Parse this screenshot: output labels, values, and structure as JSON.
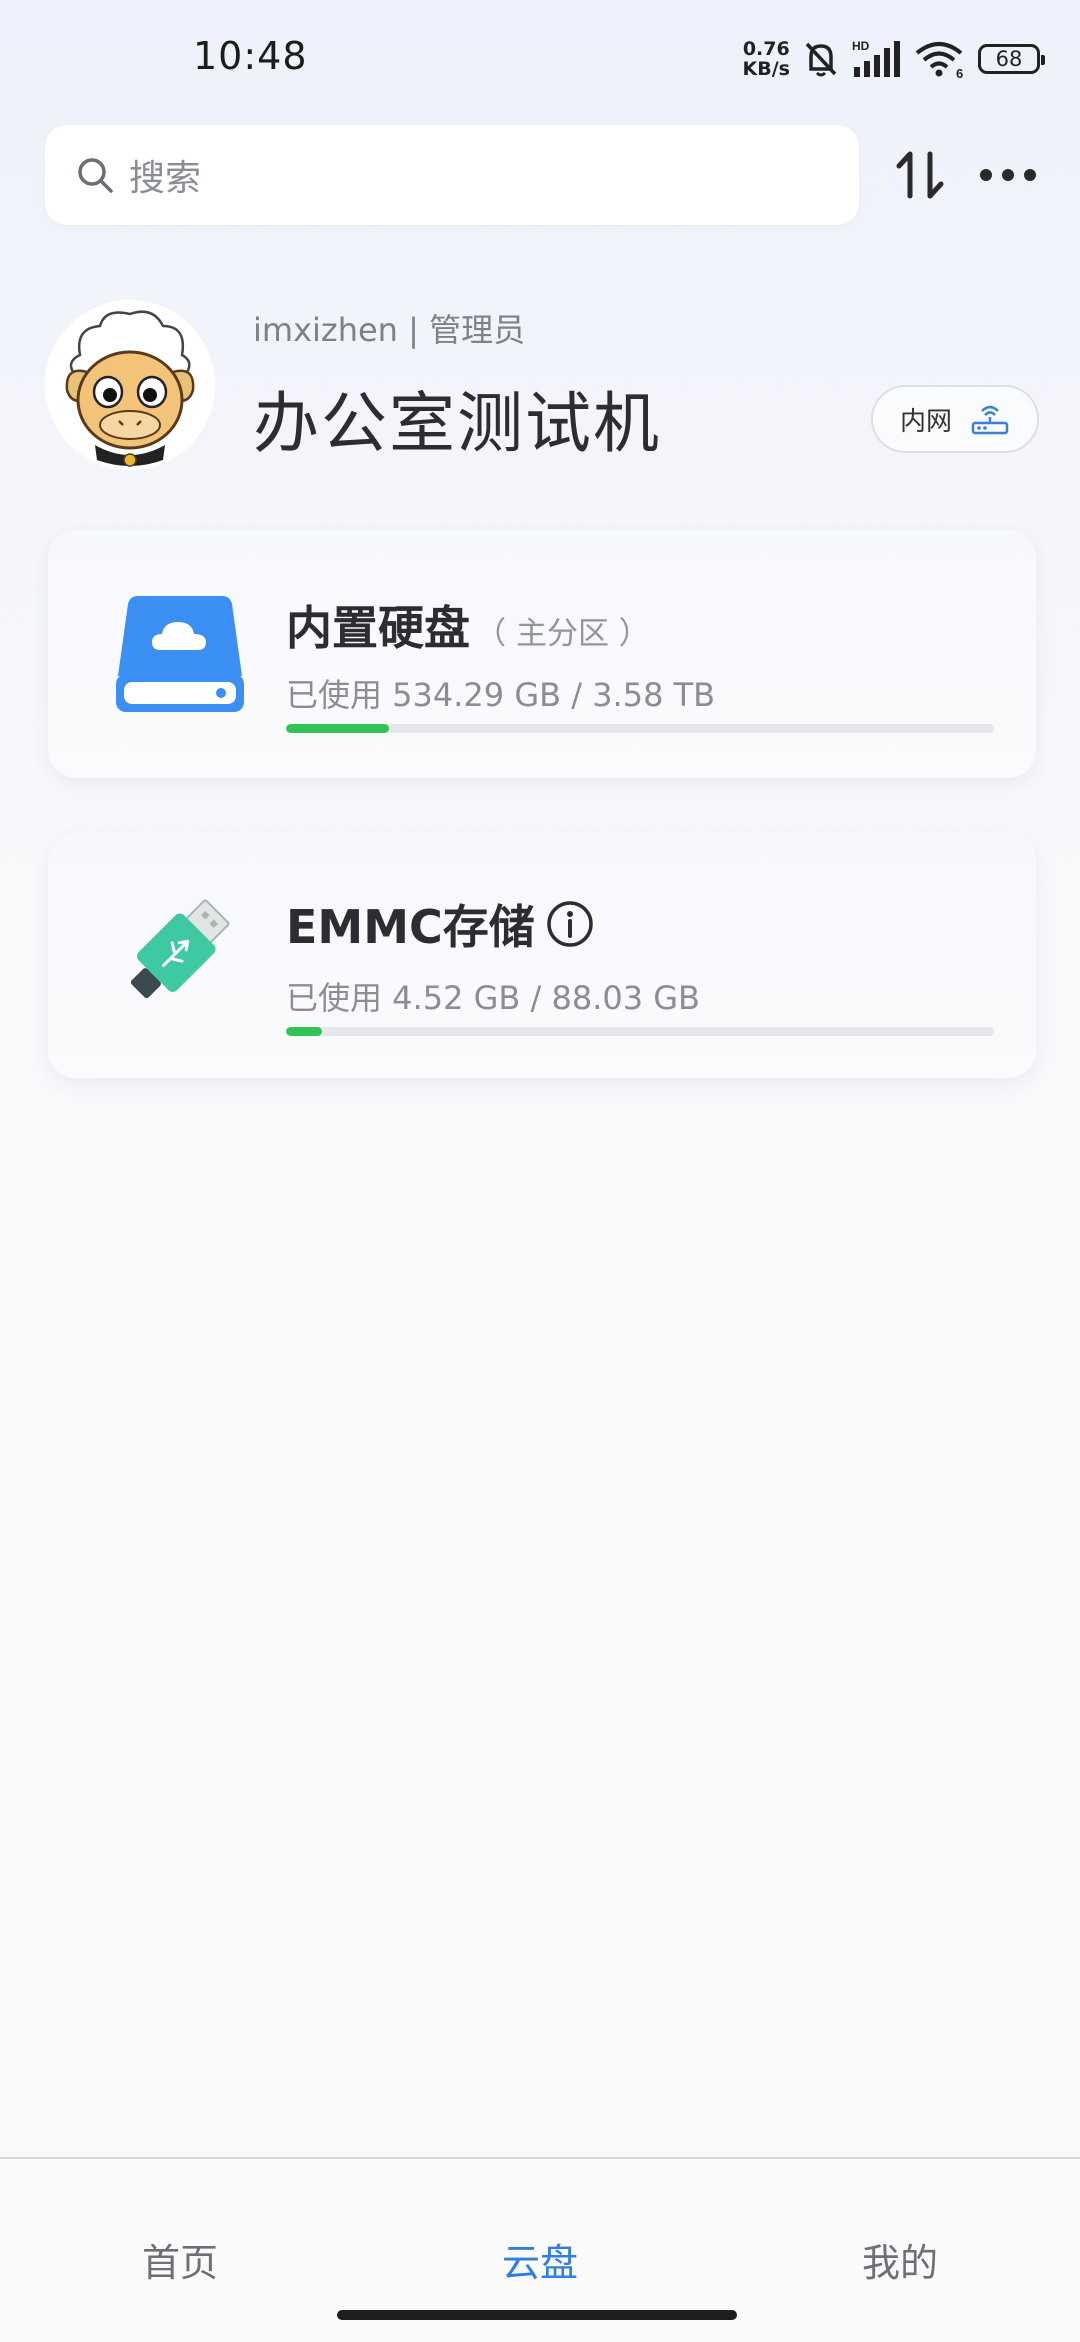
{
  "status_bar": {
    "time": "10:48",
    "net_speed_value": "0.76",
    "net_speed_unit": "KB/s",
    "battery": "68",
    "icons": [
      "mute-bell-icon",
      "signal-hd-icon",
      "wifi-6-icon",
      "battery-icon"
    ]
  },
  "search": {
    "placeholder": "搜索"
  },
  "toolbar": {
    "icons": [
      "sort-icon",
      "more-icon"
    ]
  },
  "profile": {
    "username": "imxizhen",
    "separator": "|",
    "role": "管理员",
    "device_name": "办公室测试机",
    "network_badge": "内网"
  },
  "storage": [
    {
      "title": "内置硬盘",
      "subtitle": "（ 主分区 ）",
      "usage_text": "已使用 534.29 GB / 3.58 TB",
      "used_fraction": 0.146,
      "icon": "cloud-drive-icon"
    },
    {
      "title": "EMMC存储",
      "subtitle": "",
      "usage_text": "已使用 4.52 GB / 88.03 GB",
      "used_fraction": 0.051,
      "icon": "usb-drive-icon"
    }
  ],
  "bottom_nav": {
    "items": [
      {
        "label": "首页",
        "active": false
      },
      {
        "label": "云盘",
        "active": true
      },
      {
        "label": "我的",
        "active": false
      }
    ]
  },
  "colors": {
    "accent": "#2f7fe0",
    "progress": "#2fc455",
    "drive_blue": "#3b8ef2",
    "usb_green": "#3fc9a3"
  }
}
